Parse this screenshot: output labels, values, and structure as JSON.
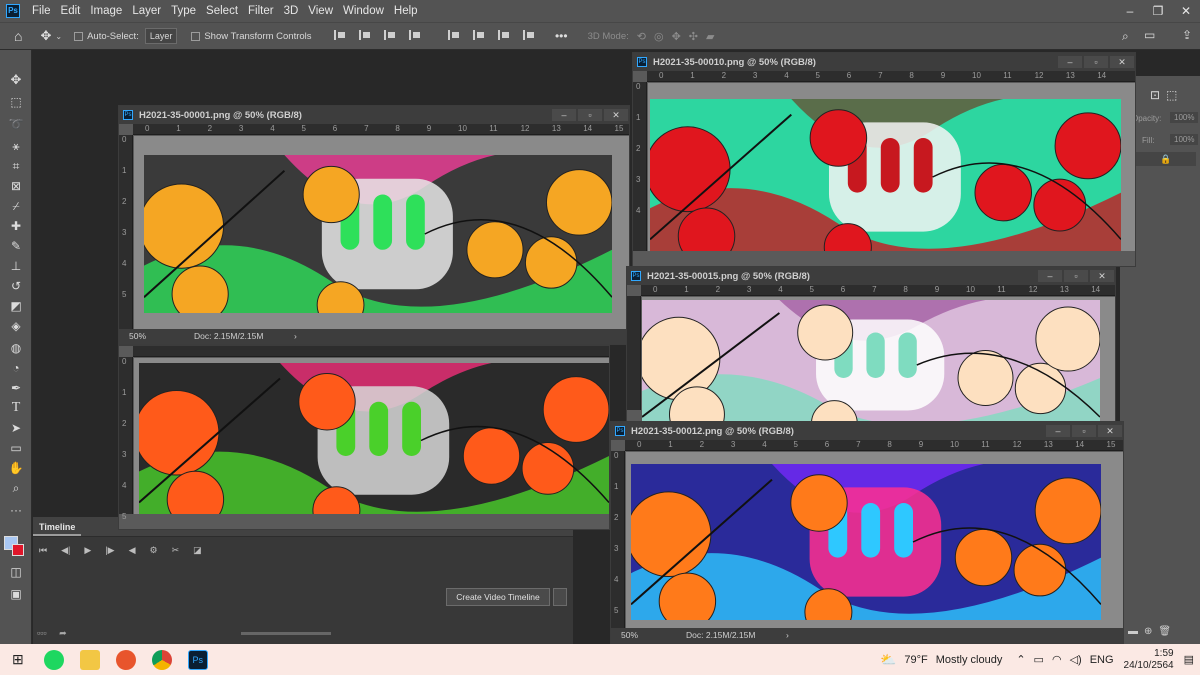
{
  "menu": [
    "File",
    "Edit",
    "Image",
    "Layer",
    "Type",
    "Select",
    "Filter",
    "3D",
    "View",
    "Window",
    "Help"
  ],
  "options": {
    "auto_select_label": "Auto-Select:",
    "layer_select": "Layer",
    "transform_label": "Show Transform Controls",
    "mode_label": "3D Mode:"
  },
  "right_panel": {
    "opacity_label": "Opacity:",
    "opacity_value": "100%",
    "fill_label": "Fill:",
    "fill_value": "100%"
  },
  "timeline": {
    "title": "Timeline",
    "create_button": "Create Video Timeline"
  },
  "documents": [
    {
      "title": "H2021-35-00001.png @ 50% (RGB/8)",
      "zoom": "50%",
      "doc_size": "Doc: 2.15M/2.15M",
      "ruler_h": [
        "0",
        "1",
        "2",
        "3",
        "4",
        "5",
        "6",
        "7",
        "8",
        "9",
        "10",
        "11",
        "12",
        "13",
        "14",
        "15"
      ],
      "ruler_v": [
        "0",
        "1",
        "2",
        "3",
        "4",
        "5"
      ],
      "palette": {
        "bg": "#3a3a3a",
        "c1": "#f5a623",
        "c2": "#2ee05a",
        "c3": "#e8e8e8",
        "c4": "#ff3fa0"
      }
    },
    {
      "title": "",
      "zoom": "",
      "doc_size": "",
      "ruler_h": [],
      "ruler_v": [
        "0",
        "1",
        "2",
        "3",
        "4",
        "5"
      ],
      "palette": {
        "bg": "#2a2a2a",
        "c1": "#ff5a1a",
        "c2": "#4ad02a",
        "c3": "#d8d8d8",
        "c4": "#ff2f7f"
      }
    },
    {
      "title": "H2021-35-00010.png @ 50% (RGB/8)",
      "zoom": "",
      "doc_size": "",
      "ruler_h": [
        "0",
        "1",
        "2",
        "3",
        "4",
        "5",
        "6",
        "7",
        "8",
        "9",
        "10",
        "11",
        "12",
        "13",
        "14"
      ],
      "ruler_v": [
        "0",
        "1",
        "2",
        "3",
        "4"
      ],
      "palette": {
        "bg": "#2dd6a0",
        "c1": "#e0161e",
        "c2": "#c7181f",
        "c3": "#f4f4f4",
        "c4": "#6a4a2e"
      }
    },
    {
      "title": "H2021-35-00015.png @ 50% (RGB/8)",
      "zoom": "",
      "doc_size": "",
      "ruler_h": [
        "0",
        "1",
        "2",
        "3",
        "4",
        "5",
        "6",
        "7",
        "8",
        "9",
        "10",
        "11",
        "12",
        "13",
        "14"
      ],
      "ruler_v": [],
      "palette": {
        "bg": "#d8b8d8",
        "c1": "#fde0c0",
        "c2": "#7fdcc0",
        "c3": "#ffffff",
        "c4": "#a05aa0"
      }
    },
    {
      "title": "H2021-35-00012.png @ 50% (RGB/8)",
      "zoom": "50%",
      "doc_size": "Doc: 2.15M/2.15M",
      "ruler_h": [
        "0",
        "1",
        "2",
        "3",
        "4",
        "5",
        "6",
        "7",
        "8",
        "9",
        "10",
        "11",
        "12",
        "13",
        "14",
        "15"
      ],
      "ruler_v": [
        "0",
        "1",
        "2",
        "3",
        "4",
        "5"
      ],
      "palette": {
        "bg": "#2a2a9a",
        "c1": "#ff7a1a",
        "c2": "#2ec8ff",
        "c3": "#ff2f8f",
        "c4": "#7a2aff"
      }
    }
  ],
  "taskbar": {
    "weather": "79°F",
    "weather_desc": "Mostly cloudy",
    "lang": "ENG",
    "time": "1:59",
    "date": "24/10/2564"
  }
}
